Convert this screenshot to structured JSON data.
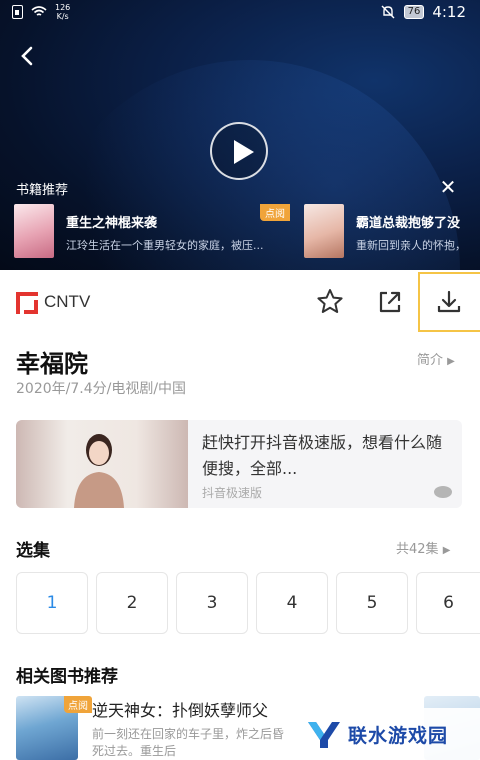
{
  "status_bar": {
    "net_speed_value": "126",
    "net_speed_unit": "K/s",
    "battery": "76",
    "time": "4:12"
  },
  "player": {
    "book_rec_title": "书籍推荐",
    "book_recs": [
      {
        "name": "重生之神棍来袭",
        "desc": "江玲生活在一个重男轻女的家庭，被压...",
        "tag": "点阅"
      },
      {
        "name": "霸道总裁抱够了没",
        "desc": "重新回到亲人的怀抱，"
      }
    ]
  },
  "info_bar": {
    "brand": "CNTV",
    "actions": [
      "star-icon",
      "share-icon",
      "download-icon"
    ]
  },
  "show": {
    "title": "幸福院",
    "brief_label": "简介",
    "meta": "2020年/7.4分/电视剧/中国"
  },
  "ad": {
    "text": "赶快打开抖音极速版，想看什么随便搜，全部...",
    "source": "抖音极速版"
  },
  "episodes": {
    "title": "选集",
    "count_label": "共42集",
    "items": [
      "1",
      "2",
      "3",
      "4",
      "5",
      "6"
    ],
    "active_index": 0
  },
  "related_books": {
    "title": "相关图书推荐",
    "items": [
      {
        "tag": "点阅",
        "name": "逆天神女：扑倒妖孽师父",
        "desc": "前一刻还在回家的车子里，炸之后昏死过去。重生后"
      }
    ]
  },
  "watermark": "联水游戏园",
  "colors": {
    "accent": "#2a8ae6",
    "brand_red": "#e3342f",
    "tag_orange": "#f0a43a",
    "highlight": "#f5c446"
  }
}
